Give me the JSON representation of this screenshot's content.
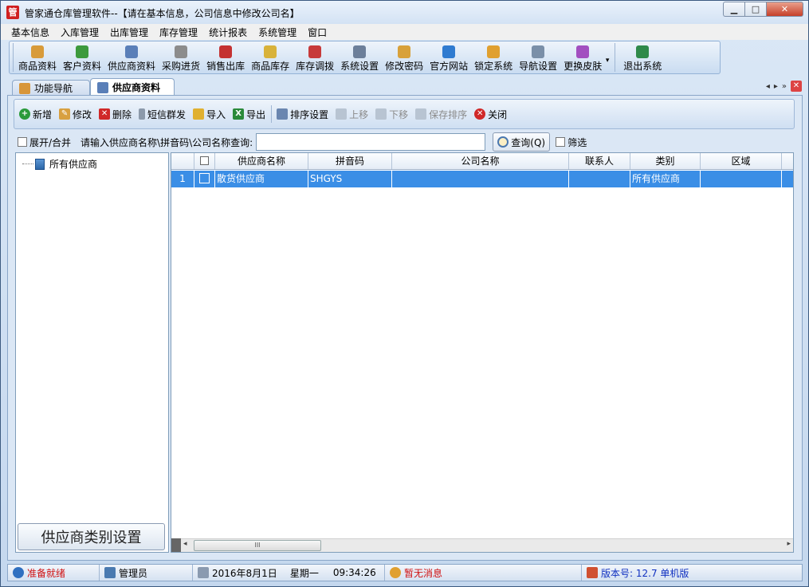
{
  "window": {
    "icon_text": "管",
    "title": "管家通仓库管理软件--【请在基本信息，公司信息中修改公司名】",
    "btn_min": "▁",
    "btn_max": "□",
    "btn_close": "✕"
  },
  "menu": [
    "基本信息",
    "入库管理",
    "出库管理",
    "库存管理",
    "统计报表",
    "系统管理",
    "窗口"
  ],
  "toolbar": [
    {
      "label": "商品资料",
      "icon": "product-icon",
      "color": "#d89b3a"
    },
    {
      "label": "客户资料",
      "icon": "customer-icon",
      "color": "#3d9a3d"
    },
    {
      "label": "供应商资料",
      "icon": "supplier-icon",
      "color": "#5a7fb8"
    },
    {
      "label": "采购进货",
      "icon": "truck-icon",
      "color": "#8c8c8c"
    },
    {
      "label": "销售出库",
      "icon": "cash-register-icon",
      "color": "#c43232"
    },
    {
      "label": "商品库存",
      "icon": "warehouse-icon",
      "color": "#d8b23a"
    },
    {
      "label": "库存调拨",
      "icon": "transfer-icon",
      "color": "#c73a3a"
    },
    {
      "label": "系统设置",
      "icon": "settings-icon",
      "color": "#6c7f9a"
    },
    {
      "label": "修改密码",
      "icon": "key-icon",
      "color": "#d8a13a"
    },
    {
      "label": "官方网站",
      "icon": "ie-icon",
      "color": "#2f7bd0"
    },
    {
      "label": "锁定系统",
      "icon": "lock-icon",
      "color": "#e0a030"
    },
    {
      "label": "导航设置",
      "icon": "navigation-icon",
      "color": "#7a8fa8"
    },
    {
      "label": "更换皮肤",
      "icon": "skin-icon",
      "color": "#a24fc0"
    },
    {
      "label": "退出系统",
      "icon": "exit-icon",
      "color": "#2f8a4a"
    }
  ],
  "tabs": [
    {
      "label": "功能导航",
      "icon_color": "#d8963a"
    },
    {
      "label": "供应商资料",
      "icon_color": "#5a7fb8"
    }
  ],
  "tab_nav": {
    "prev": "◂",
    "next": "▸",
    "menu": "»",
    "close": "✕"
  },
  "subtoolbar": {
    "add": "新增",
    "edit": "修改",
    "delete": "删除",
    "sms": "短信群发",
    "import": "导入",
    "export": "导出",
    "sort_settings": "排序设置",
    "move_up": "上移",
    "move_down": "下移",
    "save_sort": "保存排序",
    "close": "关闭"
  },
  "search": {
    "expand_label": "展开/合并",
    "prompt": "请输入供应商名称\\拼音码\\公司名称查询:",
    "value": "",
    "query_btn": "查询(Q)",
    "filter_label": "筛选"
  },
  "tree": {
    "root": "所有供应商",
    "category_button": "供应商类别设置"
  },
  "grid": {
    "columns": [
      "",
      "",
      "供应商名称",
      "拼音码",
      "公司名称",
      "联系人",
      "类别",
      "区域"
    ],
    "rows": [
      {
        "no": "1",
        "name": "散货供应商",
        "pinyin": "SHGYS",
        "company": "",
        "contact": "",
        "category": "所有供应商",
        "region": ""
      }
    ],
    "scroll_thumb": "III"
  },
  "status": {
    "ready": "准备就绪",
    "user": "管理员",
    "date": "2016年8月1日",
    "weekday": "星期一",
    "time": "09:34:26",
    "message": "暂无消息",
    "version": "版本号: 12.7 单机版"
  },
  "colors": {
    "status_red": "#d01010",
    "version_blue": "#1030c0",
    "selection": "#3a8ee6"
  }
}
